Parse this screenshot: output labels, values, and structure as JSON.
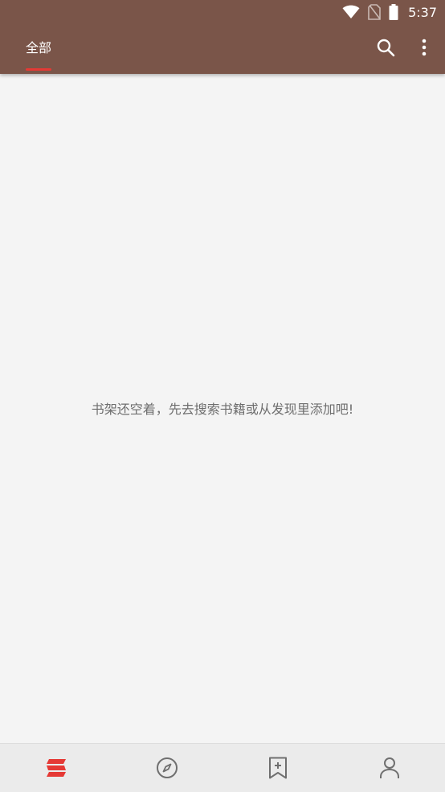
{
  "colors": {
    "toolbar": "#7a5549",
    "accent": "#e53935",
    "background": "#f4f4f4",
    "nav_background": "#ebebeb",
    "icon_inactive": "#6f6f6f"
  },
  "status_bar": {
    "time": "5:37",
    "icons": [
      "wifi-icon",
      "no-sim-icon",
      "battery-icon"
    ]
  },
  "toolbar": {
    "tab_label": "全部",
    "icons": [
      "search-icon",
      "more-vert-icon"
    ]
  },
  "main": {
    "empty_message": "书架还空着，先去搜索书籍或从发现里添加吧!"
  },
  "bottom_nav": {
    "items": [
      {
        "icon": "bookshelf-icon",
        "active": true
      },
      {
        "icon": "compass-icon",
        "active": false
      },
      {
        "icon": "bookmark-add-icon",
        "active": false
      },
      {
        "icon": "person-icon",
        "active": false
      }
    ]
  }
}
